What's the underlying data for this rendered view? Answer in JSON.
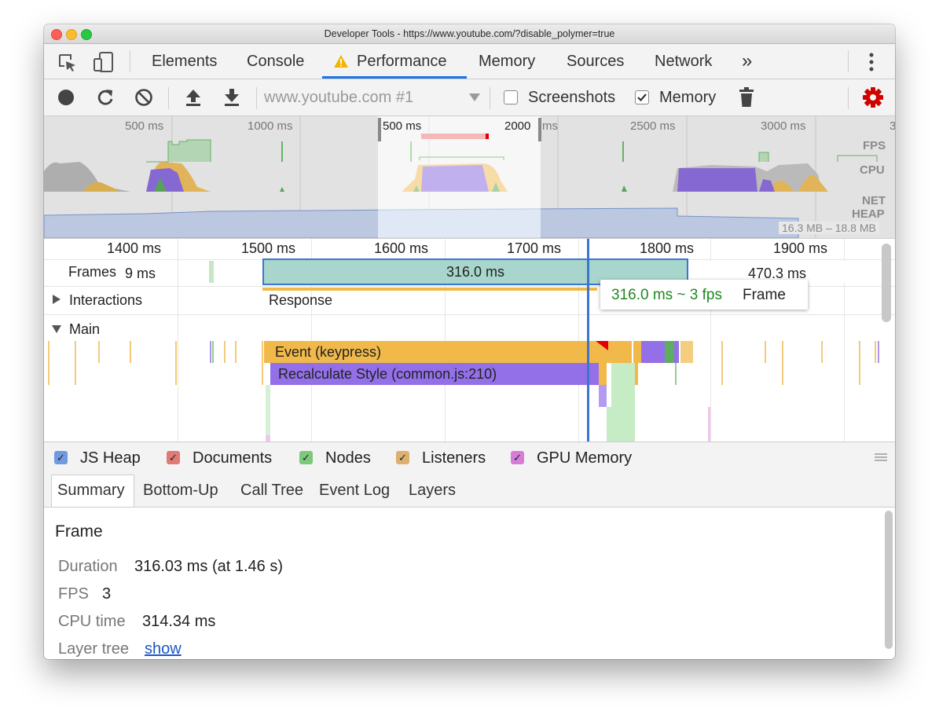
{
  "window": {
    "title": "Developer Tools - https://www.youtube.com/?disable_polymer=true"
  },
  "tabs": {
    "items": [
      "Elements",
      "Console",
      "Performance",
      "Memory",
      "Sources",
      "Network"
    ],
    "active": "Performance",
    "more": "»"
  },
  "toolbar": {
    "target_placeholder": "www.youtube.com #1",
    "screenshots_label": "Screenshots",
    "screenshots_checked": false,
    "memory_label": "Memory",
    "memory_checked": true
  },
  "overview": {
    "ticks": [
      "500 ms",
      "1000 ms",
      "500 ms",
      "2000",
      "ms",
      "2500 ms",
      "3000 ms",
      "3"
    ],
    "fps_label": "FPS",
    "cpu_label": "CPU",
    "net_label": "NET",
    "heap_label": "HEAP",
    "heap_range": "16.3 MB – 18.8 MB"
  },
  "timeline": {
    "ticks": [
      "1400 ms",
      "1500 ms",
      "1600 ms",
      "1700 ms",
      "1800 ms",
      "1900 ms"
    ],
    "frames_label": "Frames",
    "frames_prev": "9 ms",
    "frame_selected": "316.0 ms",
    "frame_next": "470.3 ms",
    "interactions_label": "Interactions",
    "interaction_response": "Response",
    "main_label": "Main",
    "event_keypress": "Event (keypress)",
    "recalc_style": "Recalculate Style (common.js:210)",
    "tooltip_fps": "316.0 ms ~ 3 fps",
    "tooltip_label": "Frame"
  },
  "legend": {
    "items": [
      {
        "label": "JS Heap",
        "color": "#4b7fd1"
      },
      {
        "label": "Documents",
        "color": "#d4605a"
      },
      {
        "label": "Nodes",
        "color": "#4cb04c"
      },
      {
        "label": "Listeners",
        "color": "#c9963f"
      },
      {
        "label": "GPU Memory",
        "color": "#c04fc0"
      }
    ]
  },
  "bottom_tabs": {
    "items": [
      "Summary",
      "Bottom-Up",
      "Call Tree",
      "Event Log",
      "Layers"
    ],
    "active": "Summary"
  },
  "summary": {
    "heading": "Frame",
    "duration_label": "Duration",
    "duration_value": "316.03 ms (at 1.46 s)",
    "fps_label": "FPS",
    "fps_value": "3",
    "cpu_label": "CPU time",
    "cpu_value": "314.34 ms",
    "layer_label": "Layer tree",
    "layer_link": "show"
  },
  "colors": {
    "accent": "#1a73e8",
    "scripting": "#f0b94a",
    "rendering": "#9370e8",
    "painting": "#7bc47f",
    "frame": "#a8d5cc",
    "tooltip_green": "#1e8a1e",
    "record_red": "#d00000"
  }
}
